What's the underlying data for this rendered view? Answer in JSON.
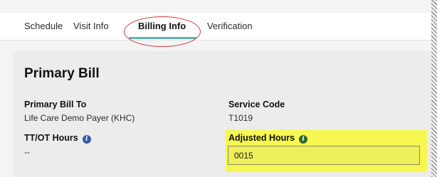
{
  "tabs": [
    {
      "label": "Schedule",
      "active": false
    },
    {
      "label": "Visit Info",
      "active": false
    },
    {
      "label": "Billing Info",
      "active": true
    },
    {
      "label": "Verification",
      "active": false
    }
  ],
  "section": {
    "title": "Primary Bill"
  },
  "fields": {
    "primary_bill_to": {
      "label": "Primary Bill To",
      "value": "Life Care Demo Payer (KHC)"
    },
    "service_code": {
      "label": "Service Code",
      "value": "T1019"
    },
    "tt_ot_hours": {
      "label": "TT/OT Hours",
      "value": "--",
      "icon": "info-icon"
    },
    "adjusted_hours": {
      "label": "Adjusted Hours",
      "value": "0015",
      "icon": "info-icon"
    }
  },
  "colors": {
    "highlight": "#f7f751",
    "annotation_circle": "#d33b3b",
    "tab_underline": "#5fb3b0",
    "info_blue": "#2e5aa8",
    "info_green": "#2f6b2f"
  }
}
